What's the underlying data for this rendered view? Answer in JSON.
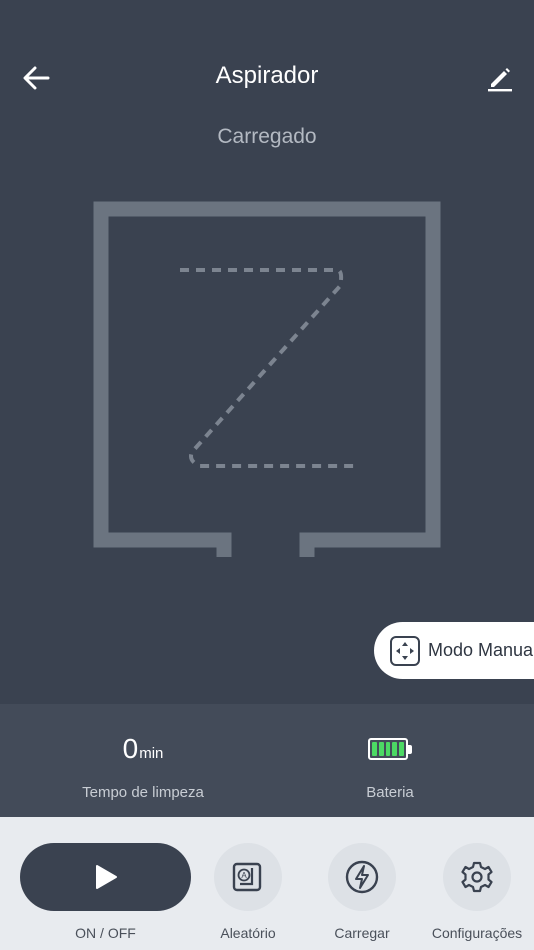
{
  "header": {
    "title": "Aspirador",
    "status": "Carregado"
  },
  "manual_mode": {
    "label": "Modo Manual"
  },
  "stats": {
    "cleaning_time": {
      "value": "0",
      "unit": "min",
      "label": "Tempo de limpeza"
    },
    "battery": {
      "label": "Bateria",
      "level_fraction": 1.0,
      "level_color": "#4cd964"
    }
  },
  "controls": {
    "onoff_label": "ON / OFF",
    "random_label": "Aleatório",
    "charge_label": "Carregar",
    "settings_label": "Configurações"
  },
  "icons": {
    "back": "arrow-left",
    "edit": "pencil",
    "manual": "four-way-arrows",
    "play": "play-triangle",
    "random": "random-mode",
    "charge": "lightning-bolt",
    "settings": "gear"
  },
  "colors": {
    "background": "#3a4250",
    "stats_background": "#434b59",
    "controls_background": "#e8ebef",
    "accent_battery": "#4cd964"
  }
}
